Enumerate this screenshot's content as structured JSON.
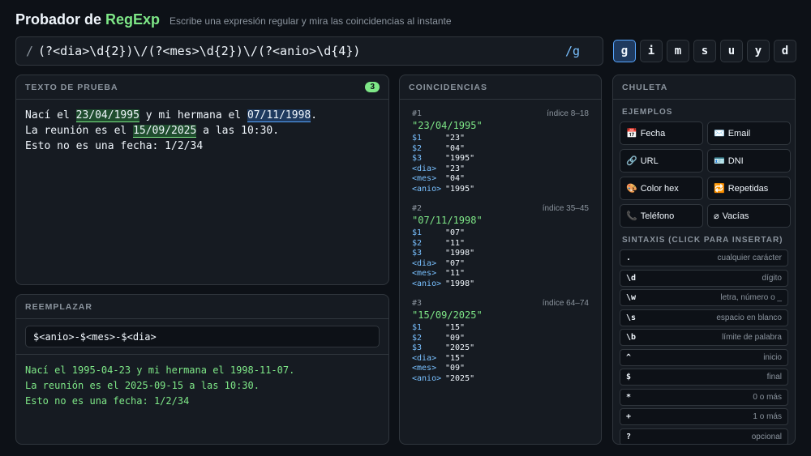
{
  "header": {
    "title_main": "Probador de ",
    "title_accent": "RegExp",
    "subtitle": "Escribe una expresión regular y mira las coincidencias al instante"
  },
  "regex": {
    "open": "/",
    "pattern": "(?<dia>\\d{2})\\/(?<mes>\\d{2})\\/(?<anio>\\d{4})",
    "flags": "/g"
  },
  "flag_buttons": [
    "g",
    "i",
    "m",
    "s",
    "u",
    "y",
    "d"
  ],
  "test_panel": {
    "label": "TEXTO DE PRUEBA",
    "count": "3",
    "line1": {
      "a": "Nací el ",
      "m1": "23/04/1995",
      "b": " y mi hermana el ",
      "m2": "07/11/1998",
      "c": "."
    },
    "line2": {
      "a": "La reunión es el ",
      "m1": "15/09/2025",
      "b": " a las 10:30."
    },
    "line3": "Esto no es una fecha: 1/2/34"
  },
  "replace_panel": {
    "label": "REEMPLAZAR",
    "value": "$<anio>-$<mes>-$<dia>",
    "output": [
      "Nací el 1995-04-23 y mi hermana el 1998-11-07.",
      "La reunión es el 2025-09-15 a las 10:30.",
      "Esto no es una fecha: 1/2/34"
    ]
  },
  "matches_panel": {
    "label": "COINCIDENCIAS",
    "matches": [
      {
        "num": "#1",
        "index": "índice 8–18",
        "value": "\"23/04/1995\"",
        "groups": [
          [
            "$1",
            "\"23\""
          ],
          [
            "$2",
            "\"04\""
          ],
          [
            "$3",
            "\"1995\""
          ],
          [
            "<dia>",
            "\"23\""
          ],
          [
            "<mes>",
            "\"04\""
          ],
          [
            "<anio>",
            "\"1995\""
          ]
        ]
      },
      {
        "num": "#2",
        "index": "índice 35–45",
        "value": "\"07/11/1998\"",
        "groups": [
          [
            "$1",
            "\"07\""
          ],
          [
            "$2",
            "\"11\""
          ],
          [
            "$3",
            "\"1998\""
          ],
          [
            "<dia>",
            "\"07\""
          ],
          [
            "<mes>",
            "\"11\""
          ],
          [
            "<anio>",
            "\"1998\""
          ]
        ]
      },
      {
        "num": "#3",
        "index": "índice 64–74",
        "value": "\"15/09/2025\"",
        "groups": [
          [
            "$1",
            "\"15\""
          ],
          [
            "$2",
            "\"09\""
          ],
          [
            "$3",
            "\"2025\""
          ],
          [
            "<dia>",
            "\"15\""
          ],
          [
            "<mes>",
            "\"09\""
          ],
          [
            "<anio>",
            "\"2025\""
          ]
        ]
      }
    ]
  },
  "cheat": {
    "label": "CHULETA",
    "examples_label": "EJEMPLOS",
    "examples": [
      {
        "icon": "📅",
        "name": "Fecha"
      },
      {
        "icon": "✉️",
        "name": "Email"
      },
      {
        "icon": "🔗",
        "name": "URL"
      },
      {
        "icon": "🪪",
        "name": "DNI"
      },
      {
        "icon": "🎨",
        "name": "Color hex"
      },
      {
        "icon": "🔁",
        "name": "Repetidas"
      },
      {
        "icon": "📞",
        "name": "Teléfono"
      },
      {
        "icon": "⌀",
        "name": "Vacías"
      }
    ],
    "syntax_label": "SINTAXIS (CLICK PARA INSERTAR)",
    "syntax": [
      {
        "tok": ".",
        "desc": "cualquier carácter"
      },
      {
        "tok": "\\d",
        "desc": "dígito"
      },
      {
        "tok": "\\w",
        "desc": "letra, número o _"
      },
      {
        "tok": "\\s",
        "desc": "espacio en blanco"
      },
      {
        "tok": "\\b",
        "desc": "límite de palabra"
      },
      {
        "tok": "^",
        "desc": "inicio"
      },
      {
        "tok": "$",
        "desc": "final"
      },
      {
        "tok": "*",
        "desc": "0 o más"
      },
      {
        "tok": "+",
        "desc": "1 o más"
      },
      {
        "tok": "?",
        "desc": "opcional"
      }
    ]
  },
  "colors": {
    "accent": "#7ee787",
    "link": "#79c0ff",
    "bg": "#0d1117",
    "panel": "#161b22"
  }
}
